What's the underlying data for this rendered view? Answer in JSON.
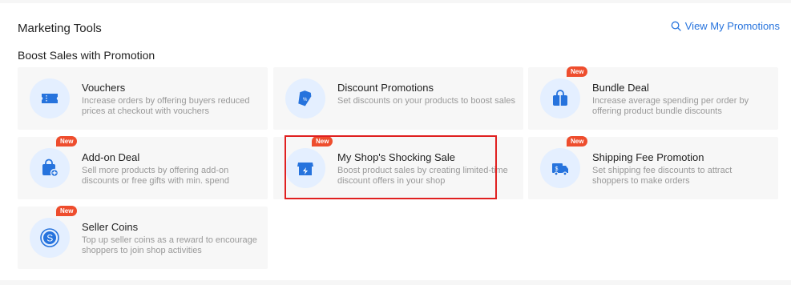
{
  "header": {
    "title": "Marketing Tools",
    "view_link": "View My Promotions"
  },
  "section": {
    "title": "Boost Sales with Promotion"
  },
  "tools": [
    {
      "name": "Vouchers",
      "desc": "Increase orders by offering buyers reduced prices at checkout with vouchers",
      "badge": "",
      "icon": "voucher-icon"
    },
    {
      "name": "Discount Promotions",
      "desc": "Set discounts on your products to boost sales",
      "badge": "",
      "icon": "price-tag-icon"
    },
    {
      "name": "Bundle Deal",
      "desc": "Increase average spending per order by offering product bundle discounts",
      "badge": "New",
      "icon": "bundle-bag-icon"
    },
    {
      "name": "Add-on Deal",
      "desc": "Sell more products by offering add-on discounts or free gifts with min. spend",
      "badge": "New",
      "icon": "shopping-bag-plus-icon"
    },
    {
      "name": "My Shop's Shocking Sale",
      "desc": "Boost product sales by creating limited-time discount offers in your shop",
      "badge": "New",
      "icon": "shop-flash-icon"
    },
    {
      "name": "Shipping Fee Promotion",
      "desc": "Set shipping fee discounts to attract shoppers to make orders",
      "badge": "New",
      "icon": "delivery-truck-icon"
    },
    {
      "name": "Seller Coins",
      "desc": "Top up seller coins as a reward to encourage shoppers to join shop activities",
      "badge": "New",
      "icon": "coin-icon"
    }
  ],
  "colors": {
    "accent": "#2673dd",
    "icon_blue": "#2673dd",
    "icon_bg": "#e4efff",
    "badge": "#ee4d2d",
    "highlight": "#e02020"
  }
}
